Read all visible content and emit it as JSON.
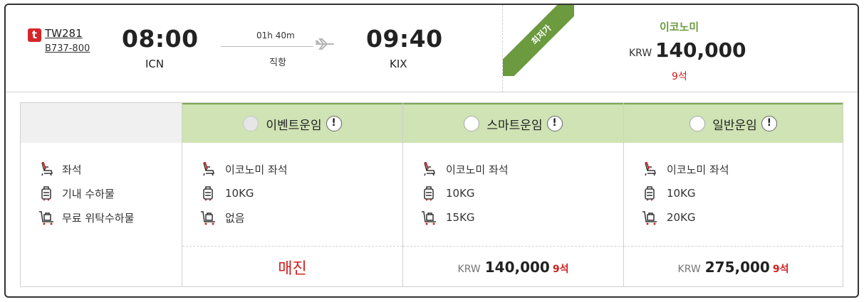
{
  "flight": {
    "airline_logo": "t",
    "flight_no": "TW281",
    "aircraft": "B737-800",
    "dep_time": "08:00",
    "dep_code": "ICN",
    "duration": "01h 40m",
    "direct": "직항",
    "arr_time": "09:40",
    "arr_code": "KIX",
    "plane_icon": "airplane-icon"
  },
  "summary": {
    "badge": "최저가",
    "cabin": "이코노미",
    "currency": "KRW",
    "price": "140,000",
    "seats": "9석"
  },
  "features": {
    "labels": [
      "좌석",
      "기내 수하물",
      "무료 위탁수하물"
    ],
    "icons": [
      "seat-icon",
      "carry-on-bag-icon",
      "checked-baggage-icon"
    ]
  },
  "fares": [
    {
      "name": "이벤트운임",
      "seat": "이코노미 좌석",
      "carry": "10KG",
      "checked": "없음",
      "status": "매진",
      "currency": "",
      "price": "",
      "seats": "",
      "selectable": false
    },
    {
      "name": "스마트운임",
      "seat": "이코노미 좌석",
      "carry": "10KG",
      "checked": "15KG",
      "status": "",
      "currency": "KRW",
      "price": "140,000",
      "seats": "9석",
      "selectable": true
    },
    {
      "name": "일반운임",
      "seat": "이코노미 좌석",
      "carry": "10KG",
      "checked": "20KG",
      "status": "",
      "currency": "KRW",
      "price": "275,000",
      "seats": "9석",
      "selectable": true
    }
  ],
  "info_glyph": "!",
  "colors": {
    "brand": "#d7262a",
    "green": "#6b9a3f",
    "header": "#cfe3b4",
    "red": "#d02020"
  }
}
